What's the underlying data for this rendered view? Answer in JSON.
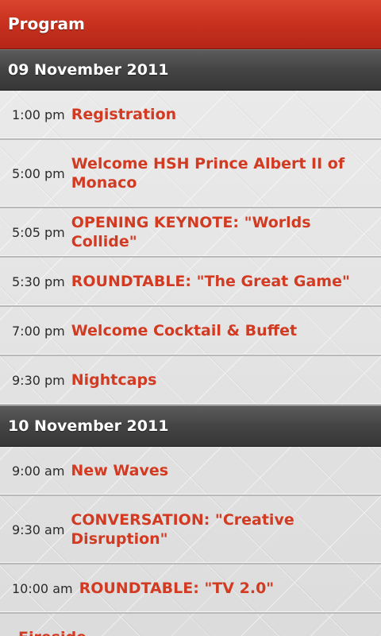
{
  "header": {
    "title": "Program"
  },
  "days": [
    {
      "date": "09 November 2011",
      "sessions": [
        {
          "time": "1:00 pm",
          "title": "Registration"
        },
        {
          "time": "5:00 pm",
          "title": "Welcome HSH Prince Albert II of Monaco"
        },
        {
          "time": "5:05 pm",
          "title": "OPENING KEYNOTE: \"Worlds Collide\""
        },
        {
          "time": "5:30 pm",
          "title": "ROUNDTABLE: \"The Great Game\""
        },
        {
          "time": "7:00 pm",
          "title": "Welcome Cocktail & Buffet"
        },
        {
          "time": "9:30 pm",
          "title": "Nightcaps"
        }
      ]
    },
    {
      "date": "10 November 2011",
      "sessions": [
        {
          "time": "9:00 am",
          "title": "New Waves"
        },
        {
          "time": "9:30 am",
          "title": "CONVERSATION: \"Creative Disruption\""
        },
        {
          "time": "10:00 am",
          "title": "ROUNDTABLE: \"TV 2.0\""
        },
        {
          "time": "",
          "title": "Fireside"
        }
      ]
    }
  ],
  "colors": {
    "accent": "#c9321f",
    "session_title": "#d23a22",
    "section_header": "#444444"
  }
}
